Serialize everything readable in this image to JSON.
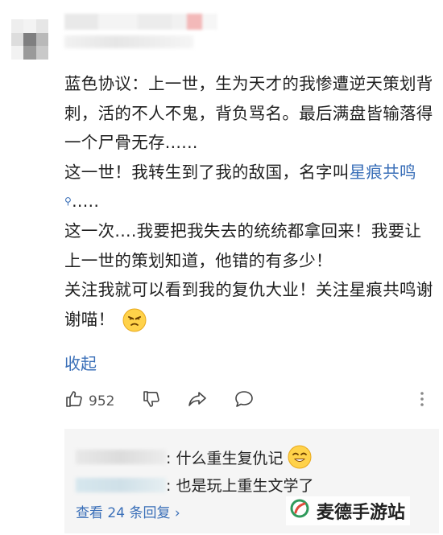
{
  "comment": {
    "lines": [
      "蓝色协议：上一世，生为天才的我惨遭逆天策划背刺，活的不人不鬼，背负骂名。最后满盘皆输落得一个尸骨无存......",
      "这一世！我转生到了我的敌国，名字叫",
      "这一次....我要把我失去的统统都拿回来！我要让上一世的策划知道，他错的有多少！",
      "关注我就可以看到我的复仇大业！关注星痕共鸣谢谢喵！"
    ],
    "link_text": "星痕共鸣",
    "after_link": ".....",
    "collapse": "收起"
  },
  "actions": {
    "like_count": "952"
  },
  "replies": {
    "items": [
      {
        "text": ": 什么重生复仇记"
      },
      {
        "text": ": 也是玩上重生文学了"
      }
    ],
    "view_more": "查看 24 条回复 ›"
  },
  "watermark": {
    "text": "麦德手游站"
  },
  "colors": {
    "link": "#3a6fb8",
    "reply_bg": "#f5f5f5"
  }
}
